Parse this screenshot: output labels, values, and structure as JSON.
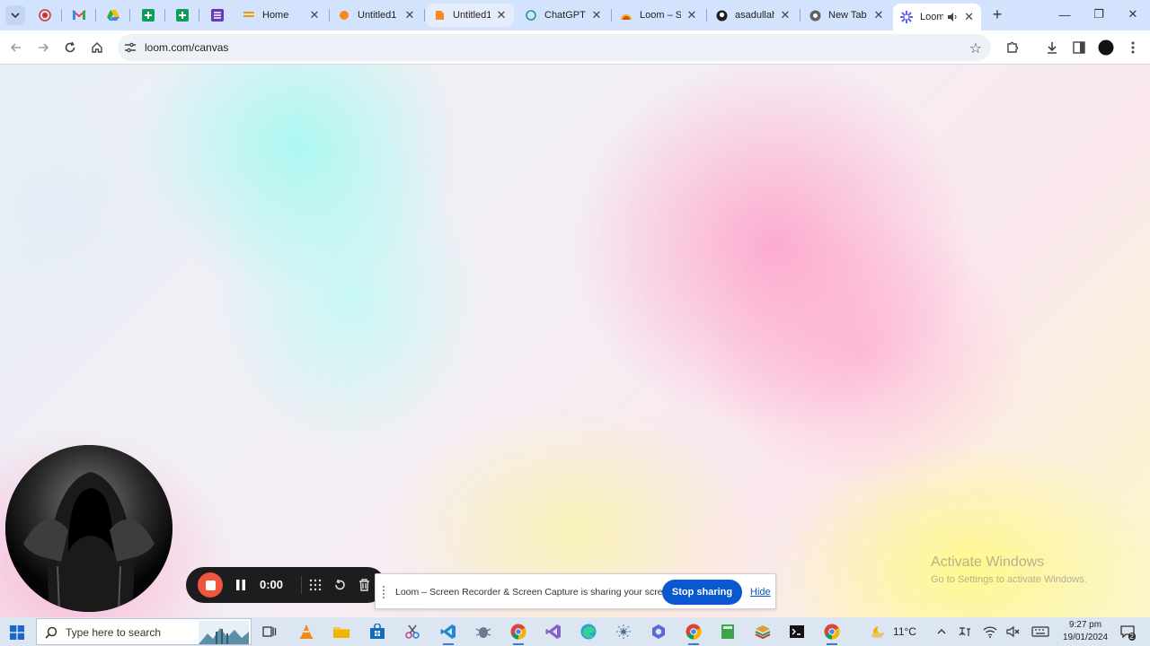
{
  "browser": {
    "tabs": [
      {
        "title": "Home",
        "close": "✕",
        "icon": "gmail-tab-icon"
      },
      {
        "title": "Untitled1",
        "close": "✕",
        "icon": "orange-doc-icon"
      },
      {
        "title": "Untitled1",
        "close": "✕",
        "icon": "orange-doc-icon"
      },
      {
        "title": "ChatGPT",
        "close": "✕",
        "icon": "chatgpt-icon"
      },
      {
        "title": "Loom – S",
        "close": "✕",
        "icon": "loom-icon"
      },
      {
        "title": "asadullah",
        "close": "✕",
        "icon": "github-icon"
      },
      {
        "title": "New Tab",
        "close": "✕",
        "icon": "chrome-icon"
      },
      {
        "title": "Loom",
        "close": "✕",
        "icon": "loom-icon",
        "active": true
      }
    ],
    "new_tab_label": "+",
    "window_controls": {
      "minimize": "—",
      "restore": "❐",
      "close": "✕"
    },
    "address": "loom.com/canvas",
    "star": "☆"
  },
  "watermark": {
    "line1": "Activate Windows",
    "line2": "Go to Settings to activate Windows."
  },
  "loom": {
    "timer": "0:00",
    "record_color": "#f0563b"
  },
  "share_bar": {
    "message": "Loom – Screen Recorder & Screen Capture is sharing your screen.",
    "stop_label": "Stop sharing",
    "hide_label": "Hide",
    "accent": "#0b57d0"
  },
  "taskbar": {
    "search_placeholder": "Type here to search",
    "weather": "11°C",
    "time": "9:27 pm",
    "date": "19/01/2024",
    "notifications": "2"
  }
}
